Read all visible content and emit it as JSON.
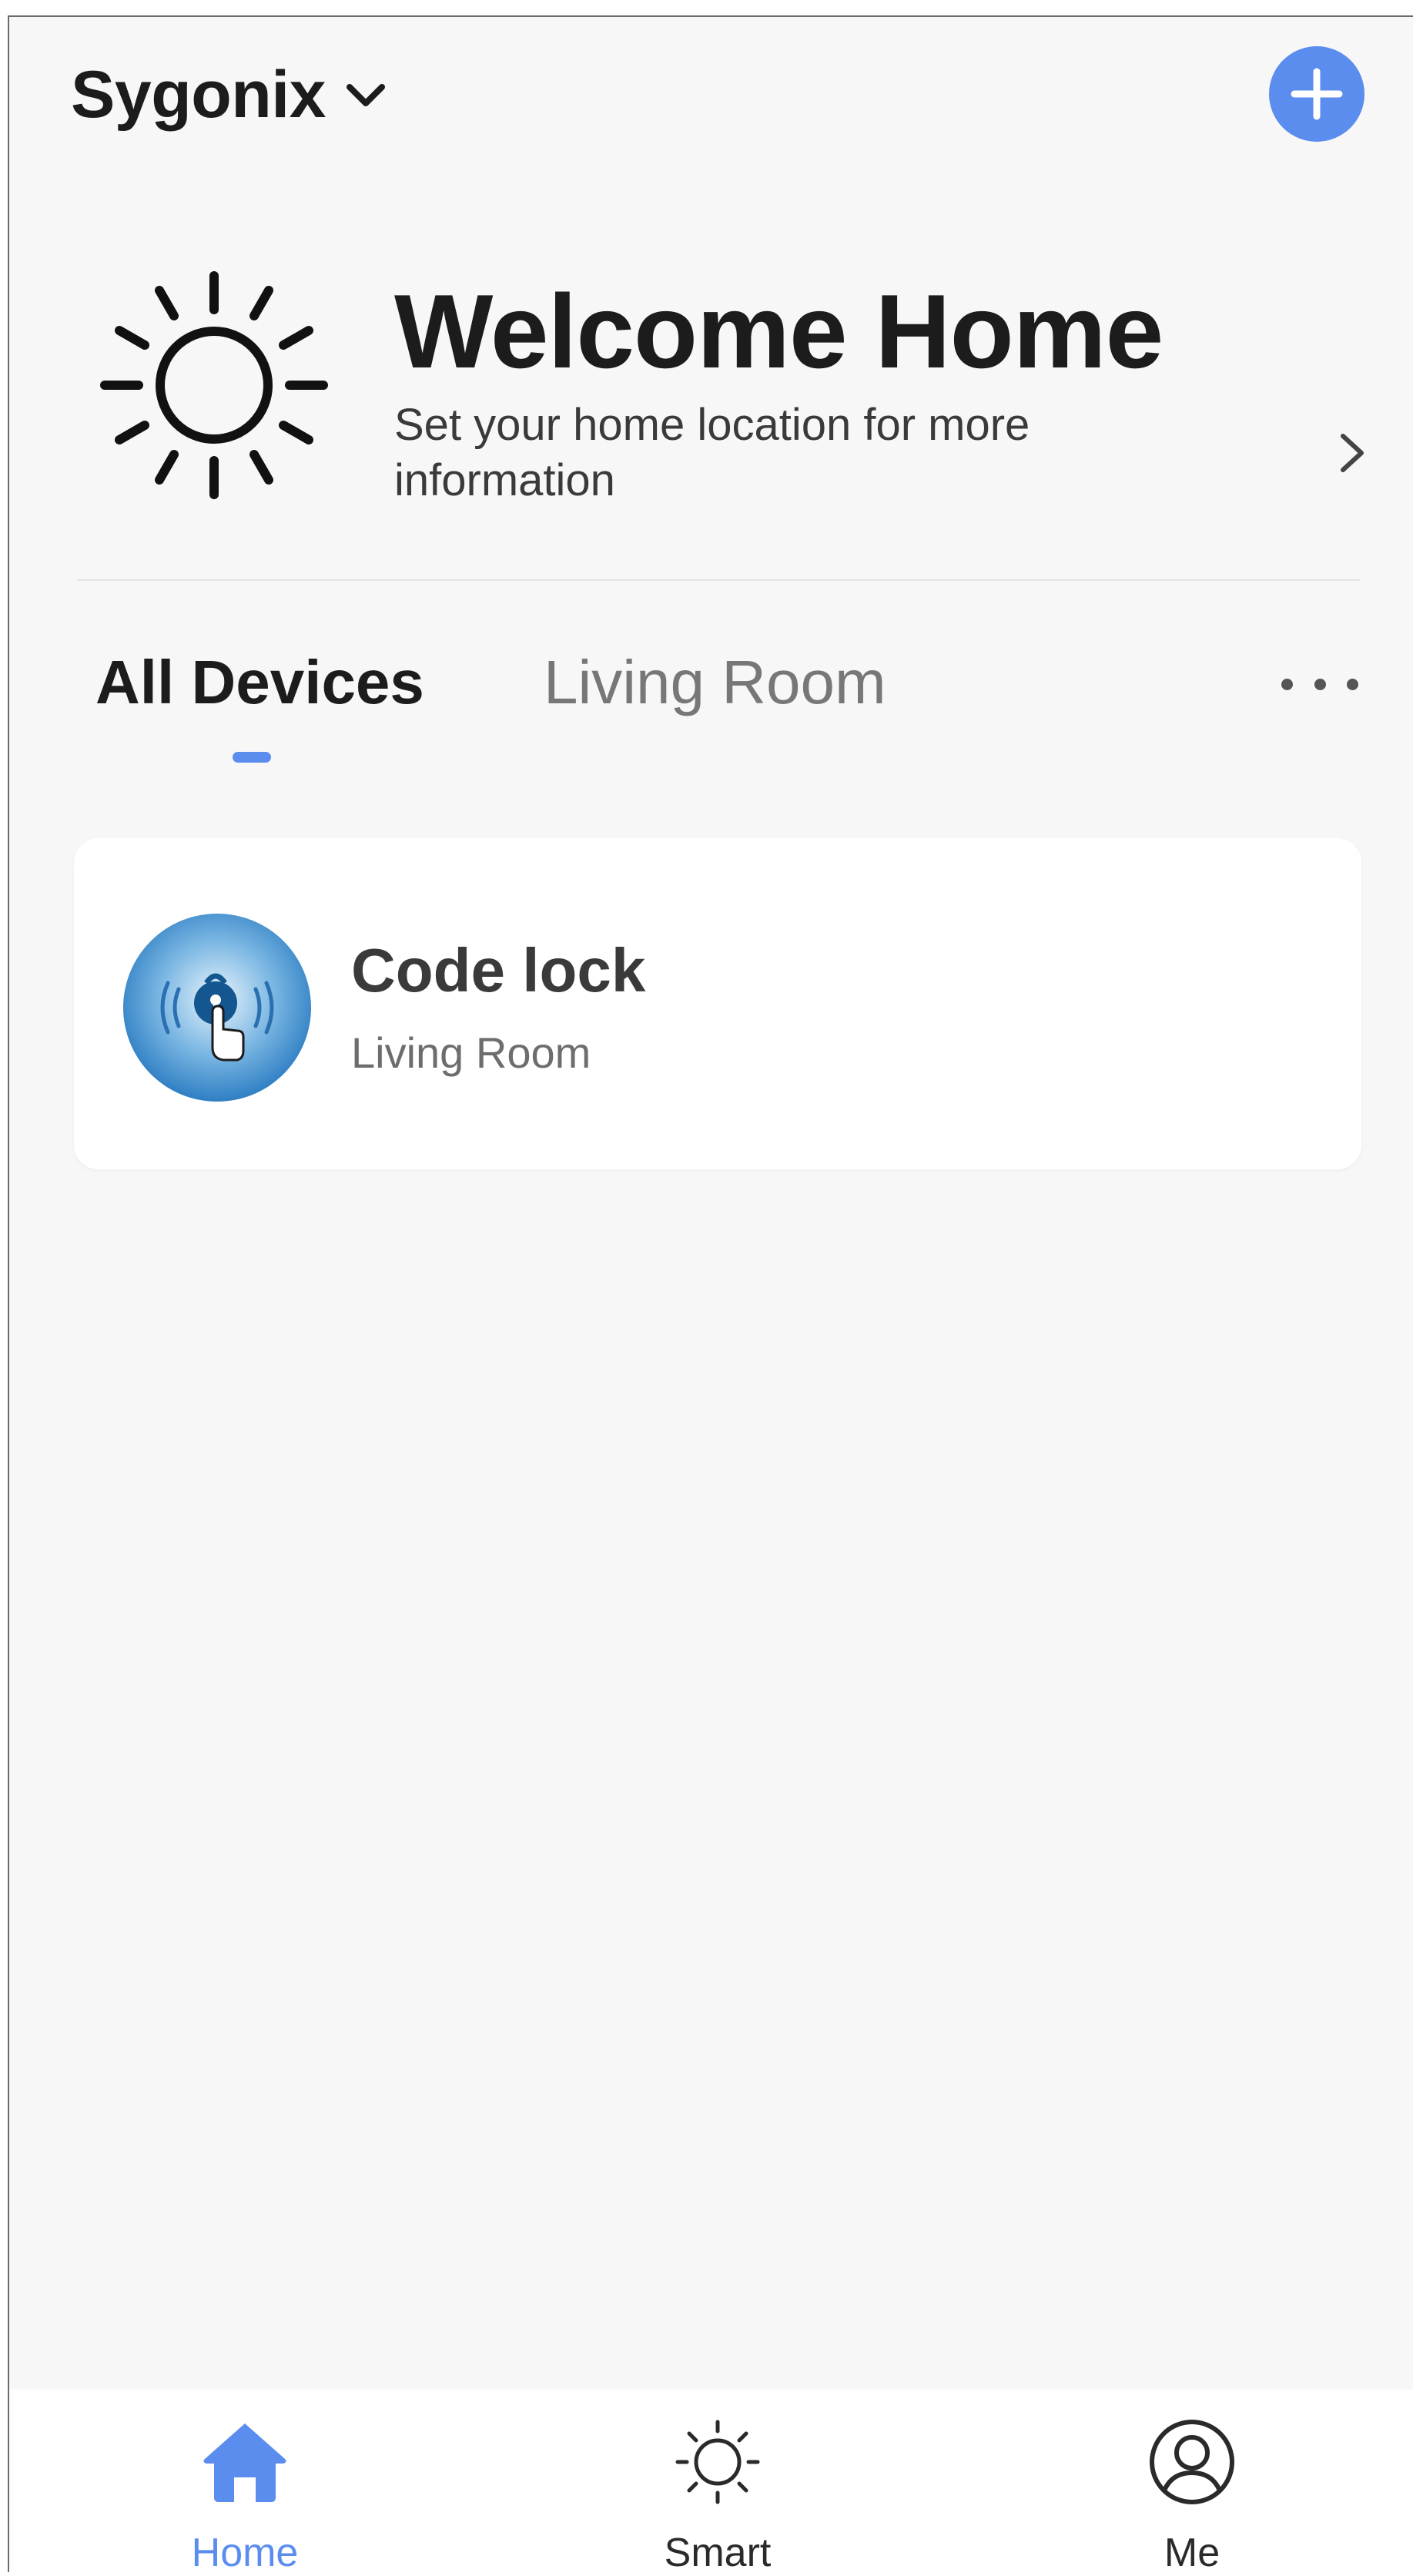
{
  "header": {
    "home_name": "Sygonix",
    "home_dropdown_icon": "chevron-down-icon",
    "add_icon": "plus-icon"
  },
  "welcome": {
    "title": "Welcome Home",
    "subtitle": "Set your home location for more information",
    "weather_icon": "sun-icon",
    "chevron_icon": "chevron-right-icon"
  },
  "tabs": {
    "items": [
      {
        "label": "All Devices",
        "active": true
      },
      {
        "label": "Living Room",
        "active": false
      }
    ],
    "more_icon": "more-dots-icon"
  },
  "devices": [
    {
      "name": "Code lock",
      "room": "Living Room",
      "icon": "code-lock-icon"
    }
  ],
  "bottom_nav": {
    "items": [
      {
        "label": "Home",
        "icon": "home-icon",
        "active": true
      },
      {
        "label": "Smart",
        "icon": "smart-sun-icon",
        "active": false
      },
      {
        "label": "Me",
        "icon": "profile-icon",
        "active": false
      }
    ]
  },
  "colors": {
    "accent": "#5b8def",
    "background": "#f7f7f8",
    "card": "#ffffff",
    "text_primary": "#1c1c1c",
    "text_secondary": "#6d6d6d"
  }
}
